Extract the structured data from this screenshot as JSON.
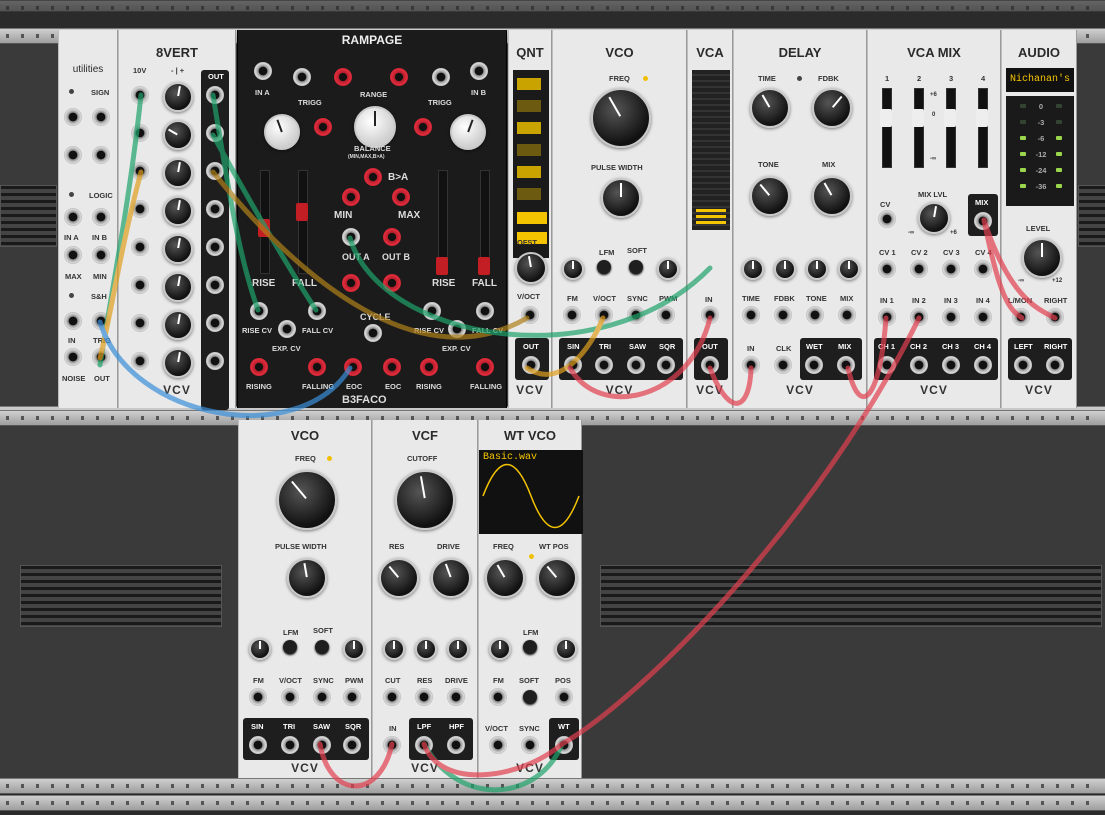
{
  "rack": {
    "rail_color": "#b5b5b5",
    "background": "#2b2b2b"
  },
  "utilities": {
    "title": "utilities",
    "sign": "SIGN",
    "logic": "LOGIC",
    "in_a": "IN A",
    "in_b": "IN B",
    "max": "MAX",
    "min": "MIN",
    "sh": "S&H",
    "in": "IN",
    "trig": "TRIG",
    "noise": "NOISE",
    "out": "OUT"
  },
  "eightvert": {
    "title": "8VERT",
    "range_left": "10V",
    "range_right": "- | +",
    "out": "OUT",
    "brand": "VCV"
  },
  "rampage": {
    "title": "RAMPAGE",
    "in_a": "IN A",
    "in_b": "IN B",
    "trigg_a": "TRIGG",
    "trigg_b": "TRIGG",
    "range": "RANGE",
    "balance": "BALANCE",
    "balance_sub": "(MIN,MAX,B>A)",
    "b_gt_a": "B>A",
    "min": "MIN",
    "max": "MAX",
    "out_a": "OUT A",
    "out_b": "OUT B",
    "rise_a": "RISE",
    "fall_a": "FALL",
    "rise_b": "RISE",
    "fall_b": "FALL",
    "rise_cv_a": "RISE CV",
    "fall_cv_a": "FALL CV",
    "rise_cv_b": "RISE CV",
    "fall_cv_b": "FALL CV",
    "exp_cv_a": "EXP. CV",
    "exp_cv_b": "EXP. CV",
    "cycle": "CYCLE",
    "rising_a": "RISING",
    "falling_a": "FALLING",
    "eoc_a": "EOC",
    "eoc_b": "EOC",
    "rising_b": "RISING",
    "falling_b": "FALLING",
    "brand": "B3FACO"
  },
  "qnt": {
    "title": "QNT",
    "ofst": "OFST",
    "voct": "V/OCT",
    "out": "OUT",
    "brand": "VCV"
  },
  "vco_top": {
    "title": "VCO",
    "freq": "FREQ",
    "pulse_width": "PULSE WIDTH",
    "lfm": "LFM",
    "soft": "SOFT",
    "fm": "FM",
    "voct": "V/OCT",
    "sync": "SYNC",
    "pwm": "PWM",
    "sin": "SIN",
    "tri": "TRI",
    "saw": "SAW",
    "sqr": "SQR",
    "brand": "VCV"
  },
  "vca": {
    "title": "VCA",
    "in": "IN",
    "out": "OUT",
    "brand": "VCV"
  },
  "delay": {
    "title": "DELAY",
    "time": "TIME",
    "fdbk": "FDBK",
    "tone": "TONE",
    "mix": "MIX",
    "in": "IN",
    "clk": "CLK",
    "wet": "WET",
    "mix_out": "MIX",
    "brand": "VCV"
  },
  "vcamix": {
    "title": "VCA MIX",
    "ch_nums": [
      "1",
      "2",
      "3",
      "4"
    ],
    "db_p6": "+6",
    "db_0": "0",
    "db_minf": "-∞",
    "cv": "CV",
    "mix_lvl": "MIX LVL",
    "mix": "MIX",
    "lvl_min": "-∞",
    "lvl_max": "+6",
    "cv_labels": [
      "CV 1",
      "CV 2",
      "CV 3",
      "CV 4"
    ],
    "in_labels": [
      "IN 1",
      "IN 2",
      "IN 3",
      "IN 4"
    ],
    "ch_labels": [
      "CH 1",
      "CH 2",
      "CH 3",
      "CH 4"
    ],
    "brand": "VCV"
  },
  "audio": {
    "title": "AUDIO",
    "device": "Nichanan's",
    "meter_labels": [
      "0",
      "-3",
      "-6",
      "-12",
      "-24",
      "-36"
    ],
    "level": "LEVEL",
    "level_min": "-∞",
    "level_max": "+12",
    "lmon": "L/MON",
    "right": "RIGHT",
    "left": "LEFT",
    "right_out": "RIGHT",
    "brand": "VCV"
  },
  "vco_bottom": {
    "title": "VCO",
    "freq": "FREQ",
    "pulse_width": "PULSE WIDTH",
    "lfm": "LFM",
    "soft": "SOFT",
    "fm": "FM",
    "voct": "V/OCT",
    "sync": "SYNC",
    "pwm": "PWM",
    "sin": "SIN",
    "tri": "TRI",
    "saw": "SAW",
    "sqr": "SQR",
    "brand": "VCV"
  },
  "vcf": {
    "title": "VCF",
    "cutoff": "CUTOFF",
    "res": "RES",
    "drive": "DRIVE",
    "cut": "CUT",
    "res_cv": "RES",
    "drive_cv": "DRIVE",
    "in": "IN",
    "lpf": "LPF",
    "hpf": "HPF",
    "brand": "VCV"
  },
  "wtvco": {
    "title": "WT VCO",
    "file": "Basic.wav",
    "freq": "FREQ",
    "wt_pos": "WT POS",
    "lfm": "LFM",
    "fm": "FM",
    "soft": "SOFT",
    "pos": "POS",
    "voct": "V/OCT",
    "sync": "SYNC",
    "wt": "WT",
    "brand": "VCV"
  },
  "cable_colors": {
    "green": "#1fa36b",
    "orange": "#e0a020",
    "blue": "#3a8fd8",
    "red": "#e24050",
    "brown": "#b0801a"
  }
}
